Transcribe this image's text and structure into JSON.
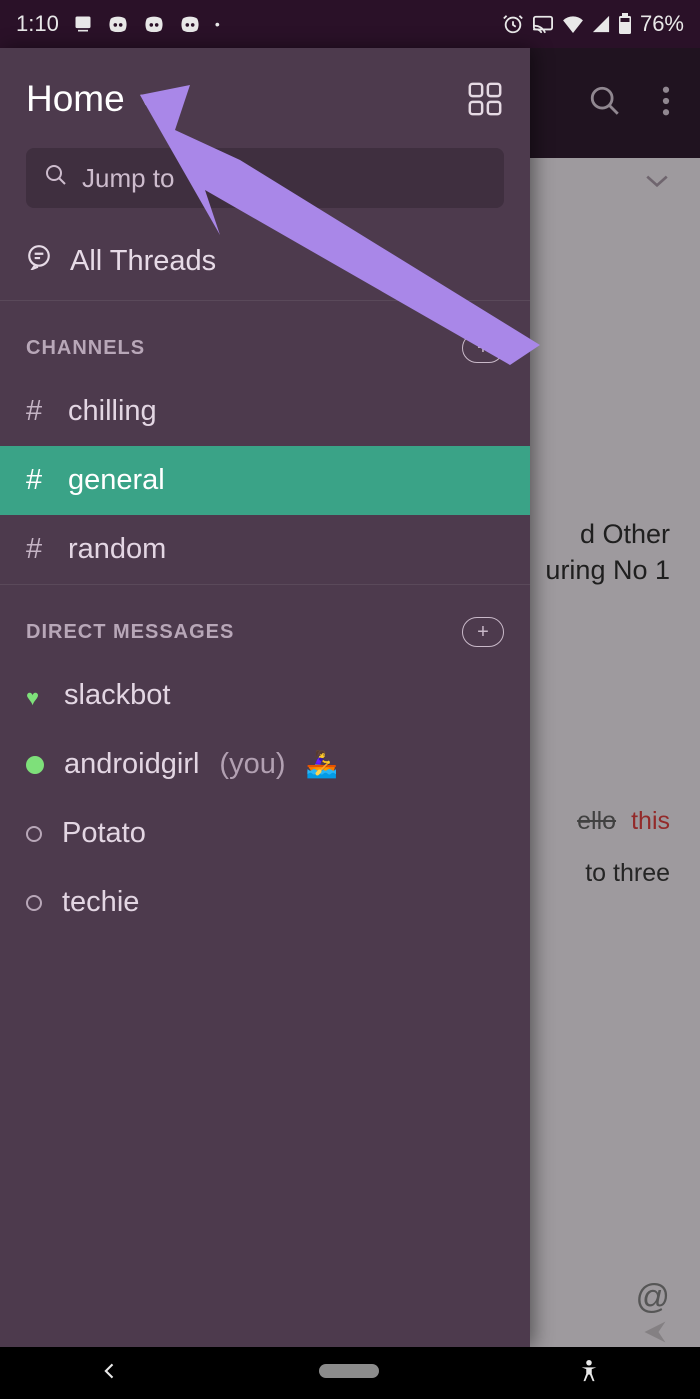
{
  "status": {
    "time": "1:10",
    "battery": "76%"
  },
  "main": {
    "msg1_line1": "d Other",
    "msg1_line2": "uring No 1",
    "code_strike": "ello",
    "code_red": "this",
    "code_line2": "to three"
  },
  "drawer": {
    "workspace": "Home",
    "search_placeholder": "Jump to",
    "threads_label": "All Threads",
    "sections": {
      "channels": {
        "label": "CHANNELS",
        "items": [
          {
            "name": "chilling",
            "active": false
          },
          {
            "name": "general",
            "active": true
          },
          {
            "name": "random",
            "active": false
          }
        ]
      },
      "dms": {
        "label": "DIRECT MESSAGES",
        "items": [
          {
            "name": "slackbot",
            "presence": "heart"
          },
          {
            "name": "androidgirl",
            "you": "(you)",
            "emoji": "🚣‍♀️",
            "presence": "online"
          },
          {
            "name": "Potato",
            "presence": "offline"
          },
          {
            "name": "techie",
            "presence": "offline"
          }
        ]
      }
    }
  },
  "colors": {
    "drawer_bg": "#4d3a4d",
    "active_bg": "#3aa387",
    "arrow": "#a987e8"
  }
}
